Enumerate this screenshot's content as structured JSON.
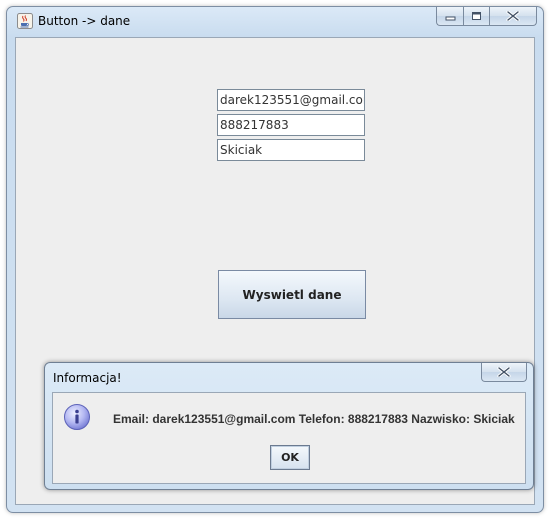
{
  "window": {
    "title": "Button -> dane"
  },
  "form": {
    "email_value": "darek123551@gmail.com",
    "phone_value": "888217883",
    "surname_value": "Skiciak",
    "show_button_label": "Wyswietl dane"
  },
  "dialog": {
    "title": "Informacja!",
    "message": "Email: darek123551@gmail.com Telefon: 888217883 Nazwisko: Skiciak",
    "ok_label": "OK",
    "icon": "info-icon"
  },
  "icons": {
    "app": "java-cup-icon",
    "minimize": "minimize-icon",
    "maximize": "maximize-icon",
    "close": "close-icon"
  },
  "colors": {
    "title_bar": "#cfe0f1",
    "content_bg": "#eeeeee",
    "info_icon": "#8a8fe0"
  }
}
